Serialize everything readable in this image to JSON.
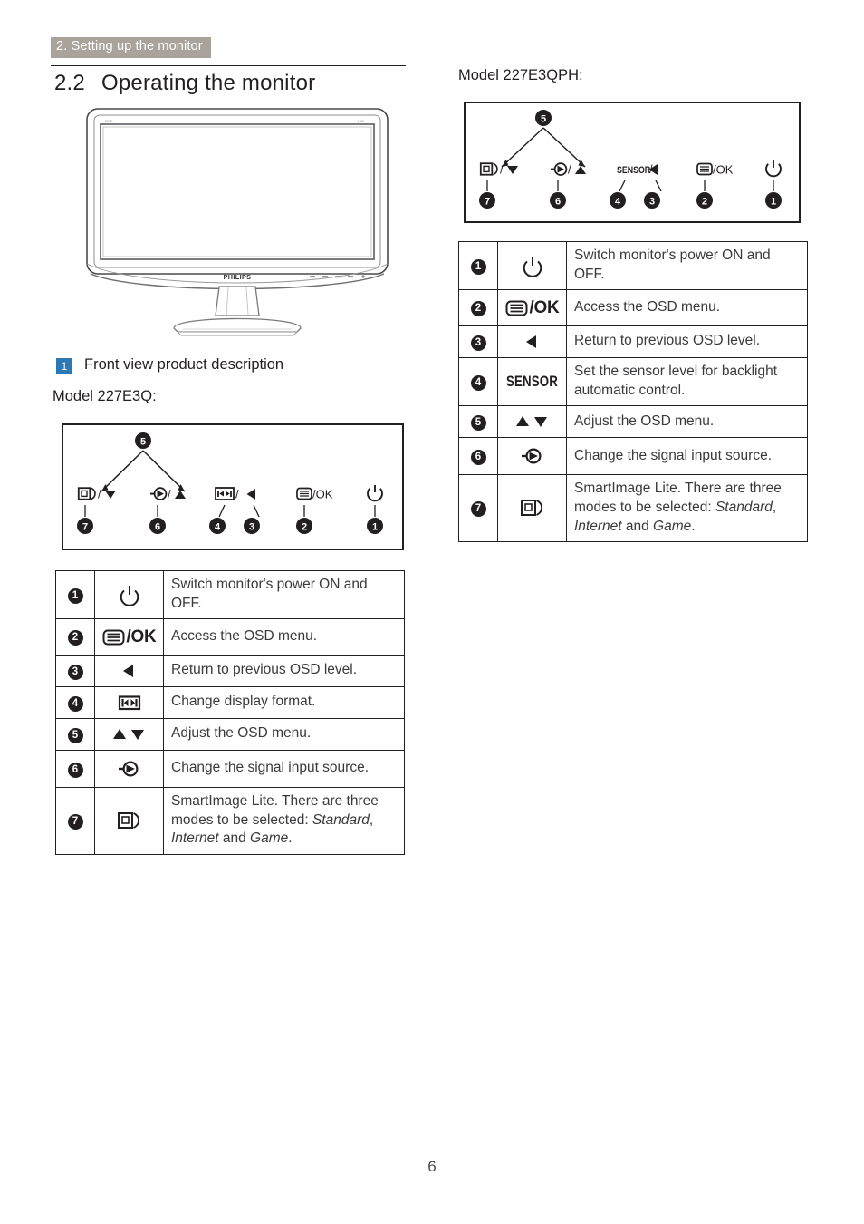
{
  "running_header": "2. Setting up the monitor",
  "section": {
    "number": "2.2",
    "title": "Operating the monitor"
  },
  "step": {
    "badge": "1",
    "label": "Front view product description"
  },
  "models": {
    "left": "Model 227E3Q:",
    "right": "Model 227E3QPH:"
  },
  "page_number": "6",
  "colors": {
    "header_band": "#a9a39b",
    "step_badge": "#2b78b4",
    "ink": "#231f20",
    "body_text": "#3a3a3c"
  },
  "monitor_illustration": {
    "brand": "PHILIPS",
    "corner_left": "227E",
    "corner_right": "LED"
  },
  "panel_left": {
    "buttons": [
      {
        "marker": "7",
        "icon": "smartimage-down-icon",
        "label": "/"
      },
      {
        "marker": "6",
        "icon": "input-source-up-icon",
        "label": "/"
      },
      {
        "marker": "4",
        "icon": "display-format-icon",
        "label": "/"
      },
      {
        "marker": "3",
        "icon": "back-arrow-icon",
        "label": ""
      },
      {
        "marker": "2",
        "icon": "osd-menu-ok-icon",
        "label": "/OK"
      },
      {
        "marker": "1",
        "icon": "power-icon",
        "label": ""
      }
    ],
    "top_marker": "5"
  },
  "panel_right": {
    "buttons": [
      {
        "marker": "7",
        "icon": "smartimage-down-icon",
        "label": "/"
      },
      {
        "marker": "6",
        "icon": "input-source-up-icon",
        "label": "/"
      },
      {
        "marker": "4",
        "icon": "sensor-text-icon",
        "label": "SENSOR/"
      },
      {
        "marker": "3",
        "icon": "back-arrow-icon",
        "label": ""
      },
      {
        "marker": "2",
        "icon": "osd-menu-ok-icon",
        "label": "/OK"
      },
      {
        "marker": "1",
        "icon": "power-icon",
        "label": ""
      }
    ],
    "top_marker": "5"
  },
  "table_left": {
    "rows": [
      {
        "num": "1",
        "icon": "power-icon",
        "icon_text": "",
        "desc": "Switch monitor's power ON and OFF."
      },
      {
        "num": "2",
        "icon": "osd-menu-ok-icon",
        "icon_text": "/OK",
        "desc": "Access the OSD menu."
      },
      {
        "num": "3",
        "icon": "back-arrow-icon",
        "icon_text": "",
        "desc": "Return to previous OSD level."
      },
      {
        "num": "4",
        "icon": "display-format-icon",
        "icon_text": "",
        "desc": "Change display format."
      },
      {
        "num": "5",
        "icon": "up-down-arrows-icon",
        "icon_text": "",
        "desc": "Adjust the OSD menu."
      },
      {
        "num": "6",
        "icon": "input-source-icon",
        "icon_text": "",
        "desc": "Change the signal input source."
      },
      {
        "num": "7",
        "icon": "smartimage-icon",
        "icon_text": "",
        "desc_parts": [
          "SmartImage Lite. There are three modes to be selected: ",
          "Standard",
          ", ",
          "Internet",
          " and ",
          "Game",
          "."
        ],
        "desc": "SmartImage Lite. There are three modes to be selected: Standard, Internet and Game."
      }
    ]
  },
  "table_right": {
    "rows": [
      {
        "num": "1",
        "icon": "power-icon",
        "icon_text": "",
        "desc": "Switch monitor's power ON and OFF."
      },
      {
        "num": "2",
        "icon": "osd-menu-ok-icon",
        "icon_text": "/OK",
        "desc": "Access the OSD menu."
      },
      {
        "num": "3",
        "icon": "back-arrow-icon",
        "icon_text": "",
        "desc": "Return to previous OSD level."
      },
      {
        "num": "4",
        "icon": "sensor-text-icon",
        "icon_text": "SENSOR",
        "desc": "Set the sensor level for backlight automatic control."
      },
      {
        "num": "5",
        "icon": "up-down-arrows-icon",
        "icon_text": "",
        "desc": "Adjust the OSD menu."
      },
      {
        "num": "6",
        "icon": "input-source-icon",
        "icon_text": "",
        "desc": "Change the signal input source."
      },
      {
        "num": "7",
        "icon": "smartimage-icon",
        "icon_text": "",
        "desc_parts": [
          "SmartImage Lite. There are three modes to be selected: ",
          "Standard",
          ", ",
          "Internet",
          " and ",
          "Game",
          "."
        ],
        "desc": "SmartImage Lite. There are three modes to be selected: Standard, Internet and Game."
      }
    ]
  }
}
